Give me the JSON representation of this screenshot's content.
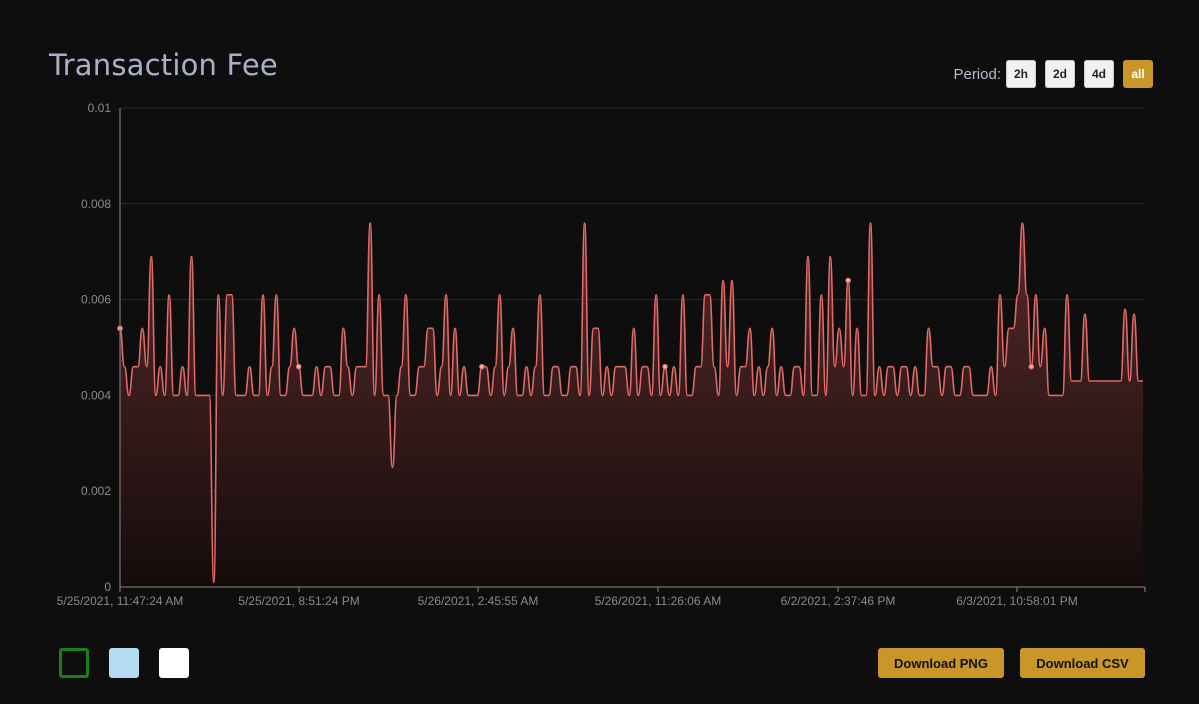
{
  "title": "Transaction Fee",
  "period": {
    "label": "Period:",
    "options": [
      "2h",
      "2d",
      "4d",
      "all"
    ],
    "selected": "all"
  },
  "colors": {
    "line": "#e06a66",
    "area_top": "#5a2a2a",
    "grid": "#2a2a2a",
    "accent": "#c9962a",
    "background": "#0e0e0f"
  },
  "swatches": [
    {
      "name": "green-outline",
      "fill": "#0e0e0f",
      "border": "#1b7d1b"
    },
    {
      "name": "light-blue",
      "fill": "#b4dcf3",
      "border": "#b4dcf3"
    },
    {
      "name": "white",
      "fill": "#ffffff",
      "border": "#ffffff"
    }
  ],
  "buttons": {
    "download_png": "Download PNG",
    "download_csv": "Download CSV"
  },
  "chart_data": {
    "type": "area",
    "title": "Transaction Fee",
    "xlabel": "",
    "ylabel": "",
    "ylim": [
      0,
      0.01
    ],
    "yticks": [
      "0.01",
      "0.008",
      "0.006",
      "0.004",
      "0.002",
      "0"
    ],
    "xticks": [
      "5/25/2021, 11:47:24 AM",
      "5/25/2021, 8:51:24 PM",
      "5/26/2021, 2:45:55 AM",
      "5/26/2021, 11:26:06 AM",
      "6/2/2021, 2:37:46 PM",
      "6/3/2021, 10:58:01 PM"
    ],
    "grid": true,
    "legend": "none",
    "values": [
      0.0054,
      0.0046,
      0.004,
      0.0046,
      0.0046,
      0.0054,
      0.0046,
      0.0069,
      0.004,
      0.0046,
      0.004,
      0.0061,
      0.004,
      0.004,
      0.0046,
      0.004,
      0.0069,
      0.004,
      0.004,
      0.004,
      0.004,
      0.0001,
      0.0061,
      0.004,
      0.0061,
      0.0061,
      0.004,
      0.004,
      0.004,
      0.0046,
      0.004,
      0.004,
      0.0061,
      0.004,
      0.0046,
      0.0061,
      0.004,
      0.004,
      0.0046,
      0.0054,
      0.0046,
      0.004,
      0.004,
      0.004,
      0.0046,
      0.004,
      0.0046,
      0.0046,
      0.004,
      0.004,
      0.0054,
      0.0046,
      0.004,
      0.0046,
      0.0046,
      0.0046,
      0.0076,
      0.004,
      0.0061,
      0.004,
      0.004,
      0.0025,
      0.004,
      0.0046,
      0.0061,
      0.004,
      0.004,
      0.0046,
      0.0046,
      0.0054,
      0.0054,
      0.004,
      0.0046,
      0.0061,
      0.004,
      0.0054,
      0.004,
      0.0046,
      0.004,
      0.004,
      0.004,
      0.0046,
      0.0046,
      0.004,
      0.0046,
      0.0061,
      0.004,
      0.0046,
      0.0054,
      0.004,
      0.004,
      0.0046,
      0.004,
      0.0046,
      0.0061,
      0.004,
      0.004,
      0.0046,
      0.0046,
      0.004,
      0.004,
      0.0046,
      0.0046,
      0.004,
      0.0076,
      0.004,
      0.0054,
      0.0054,
      0.004,
      0.0046,
      0.004,
      0.0046,
      0.0046,
      0.0046,
      0.004,
      0.0054,
      0.004,
      0.0046,
      0.0046,
      0.004,
      0.0061,
      0.004,
      0.0046,
      0.004,
      0.0046,
      0.004,
      0.0061,
      0.004,
      0.004,
      0.0046,
      0.0046,
      0.0061,
      0.0061,
      0.0046,
      0.004,
      0.0064,
      0.0046,
      0.0064,
      0.004,
      0.0046,
      0.0046,
      0.0054,
      0.004,
      0.0046,
      0.004,
      0.0046,
      0.0054,
      0.004,
      0.0046,
      0.004,
      0.004,
      0.0046,
      0.0046,
      0.004,
      0.0069,
      0.004,
      0.004,
      0.0061,
      0.004,
      0.0069,
      0.0046,
      0.0054,
      0.0046,
      0.0064,
      0.004,
      0.0054,
      0.004,
      0.004,
      0.0076,
      0.004,
      0.0046,
      0.004,
      0.0046,
      0.0046,
      0.004,
      0.0046,
      0.0046,
      0.004,
      0.0046,
      0.004,
      0.004,
      0.0054,
      0.0046,
      0.0046,
      0.004,
      0.0046,
      0.0046,
      0.004,
      0.004,
      0.0046,
      0.0046,
      0.004,
      0.004,
      0.004,
      0.004,
      0.0046,
      0.004,
      0.0061,
      0.0046,
      0.0054,
      0.0054,
      0.0061,
      0.0076,
      0.0061,
      0.0046,
      0.0061,
      0.0046,
      0.0054,
      0.004,
      0.004,
      0.004,
      0.004,
      0.0061,
      0.0043,
      0.0043,
      0.0043,
      0.0057,
      0.0043,
      0.0043,
      0.0043,
      0.0043,
      0.0043,
      0.0043,
      0.0043,
      0.0043,
      0.0058,
      0.0043,
      0.0057,
      0.0043,
      0.0043
    ]
  }
}
